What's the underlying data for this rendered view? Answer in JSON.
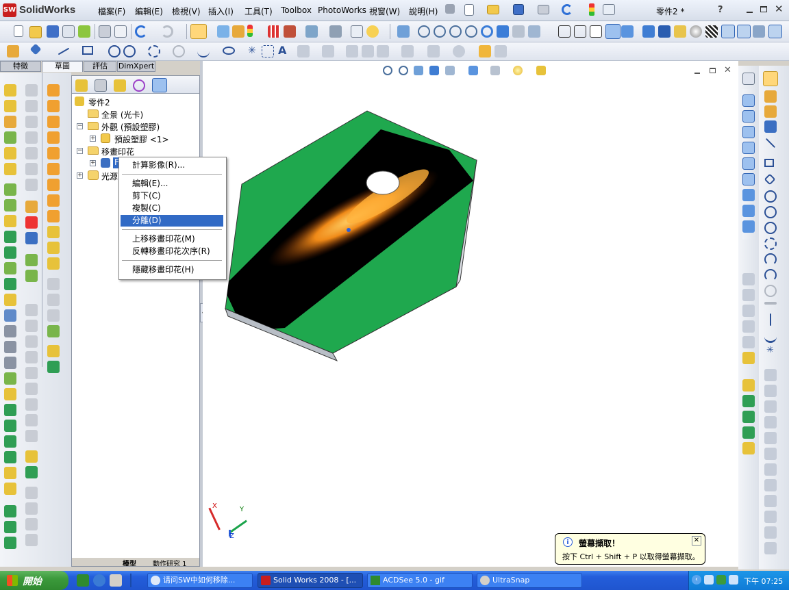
{
  "app": {
    "logo_text": "SolidWorks",
    "title": "零件2 *",
    "help_label": "?"
  },
  "menus": [
    "檔案(F)",
    "編輯(E)",
    "檢視(V)",
    "插入(I)",
    "工具(T)",
    "Toolbox",
    "PhotoWorks",
    "視窗(W)",
    "說明(H)"
  ],
  "manager_tabs": [
    "特徵",
    "草圖",
    "評估",
    "DimXpert"
  ],
  "feature_tree": {
    "root": "零件2",
    "items": [
      {
        "label": "全景 (光卡)"
      },
      {
        "label": "外觀 (預設塑膠)"
      },
      {
        "label": "預設塑膠 <1>"
      },
      {
        "label": "移畫印花"
      },
      {
        "label": "F"
      },
      {
        "label": "光源"
      }
    ],
    "bottom_tabs": [
      "模型",
      "動作研究 1"
    ]
  },
  "context_menu": {
    "items": [
      {
        "label": "計算影像(R)..."
      },
      {
        "label": "編輯(E)..."
      },
      {
        "label": "剪下(C)"
      },
      {
        "label": "複製(C)"
      },
      {
        "label": "分離(D)",
        "selected": true
      },
      {
        "label": "上移移畫印花(M)"
      },
      {
        "label": "反轉移畫印花次序(R)"
      },
      {
        "label": "隱藏移畫印花(H)"
      }
    ]
  },
  "triad": {
    "x": "X",
    "y": "Y",
    "z": "Z"
  },
  "notification": {
    "title": "螢幕擷取！",
    "body": "按下 Ctrl + Shift + P 以取得螢幕擷取。"
  },
  "taskbar": {
    "start_label": "開始",
    "items": [
      {
        "label": "请问SW中如何移除..."
      },
      {
        "label": "Solid Works 2008 - [..."
      },
      {
        "label": "ACDSee 5.0 - gif"
      },
      {
        "label": "UltraSnap"
      }
    ],
    "clock": "下午 07:25"
  },
  "colors": {
    "accent_blue": "#316ac5",
    "part_green": "#1fa84e",
    "decal_black": "#000000",
    "taskbar_blue": "#245edb",
    "start_green": "#3c9a3c",
    "logo_red": "#c81e1e"
  }
}
